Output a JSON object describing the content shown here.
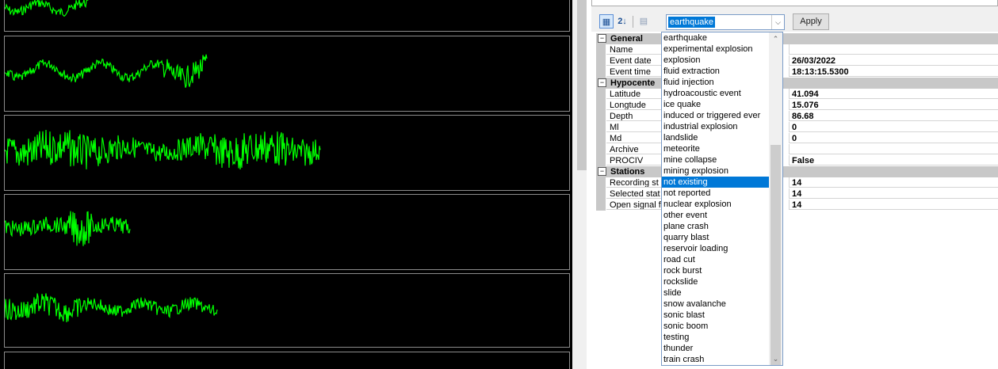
{
  "toolbar": {
    "categorized_icon": "categorized-icon",
    "alphabetical_icon": "sort-alpha-icon",
    "alphabetical_label": "2↓",
    "property_pages_icon": "property-pages-icon",
    "event_type_value": "earthquake",
    "apply_label": "Apply"
  },
  "grid": {
    "categories": [
      {
        "label": "General",
        "rows": [
          {
            "name": "Name",
            "value": ""
          },
          {
            "name": "Event date",
            "value": "26/03/2022"
          },
          {
            "name": "Event time",
            "value": "18:13:15.5300"
          }
        ]
      },
      {
        "label": "Hypocente",
        "rows": [
          {
            "name": "Latitude",
            "value": "41.094"
          },
          {
            "name": "Longtude",
            "value": "15.076"
          },
          {
            "name": "Depth",
            "value": "86.68"
          },
          {
            "name": "Ml",
            "value": "0"
          },
          {
            "name": "Md",
            "value": "0"
          },
          {
            "name": "Archive",
            "value": ""
          },
          {
            "name": "PROCIV",
            "value": "False"
          }
        ]
      },
      {
        "label": "Stations",
        "rows": [
          {
            "name": "Recording st",
            "value": "14"
          },
          {
            "name": "Selected stat",
            "value": "14"
          },
          {
            "name": "Open signal f",
            "value": "14"
          }
        ]
      }
    ],
    "collapse_symbol": "⊟"
  },
  "dropdown": {
    "selected_index": 13,
    "items": [
      "earthquake",
      "experimental explosion",
      "explosion",
      "fluid extraction",
      "fluid injection",
      "hydroacoustic event",
      "ice quake",
      "induced or triggered ever",
      "industrial explosion",
      "landslide",
      "meteorite",
      "mine collapse",
      "mining explosion",
      "not existing",
      "not reported",
      "nuclear explosion",
      "other event",
      "plane crash",
      "quarry blast",
      "reservoir loading",
      "road cut",
      "rock burst",
      "rockslide",
      "slide",
      "snow avalanche",
      "sonic blast",
      "sonic boom",
      "testing",
      "thunder",
      "train crash"
    ]
  },
  "colors": {
    "trace": "#00ff00",
    "background": "#000000",
    "selection": "#0078d7"
  }
}
